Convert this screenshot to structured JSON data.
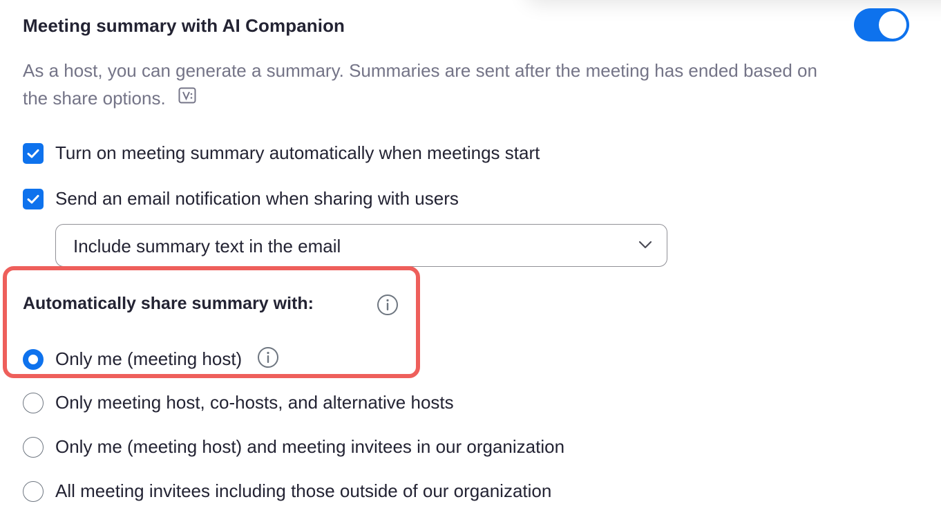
{
  "setting": {
    "title": "Meeting summary with AI Companion",
    "enabled": true,
    "description": "As a host, you can generate a summary. Summaries are sent after the meeting has ended based on the share options.",
    "description_icon": "v-badge-icon"
  },
  "options": {
    "auto_start": {
      "label": "Turn on meeting summary automatically when meetings start",
      "checked": true
    },
    "email_notification": {
      "label": "Send an email notification when sharing with users",
      "checked": true
    }
  },
  "email_content_select": {
    "value": "Include summary text in the email",
    "icon": "chevron-down-icon"
  },
  "share": {
    "label": "Automatically share summary with:",
    "label_icon": "info-icon",
    "choices": [
      {
        "label": "Only me (meeting host)",
        "selected": true,
        "has_info": true
      },
      {
        "label": "Only meeting host, co-hosts, and alternative hosts",
        "selected": false
      },
      {
        "label": "Only me (meeting host) and meeting invitees in our organization",
        "selected": false
      },
      {
        "label": "All meeting invitees including those outside of our organization",
        "selected": false
      }
    ]
  },
  "colors": {
    "accent": "#0e72ed",
    "highlight_border": "#ee5f5b",
    "muted_text": "#747487"
  }
}
